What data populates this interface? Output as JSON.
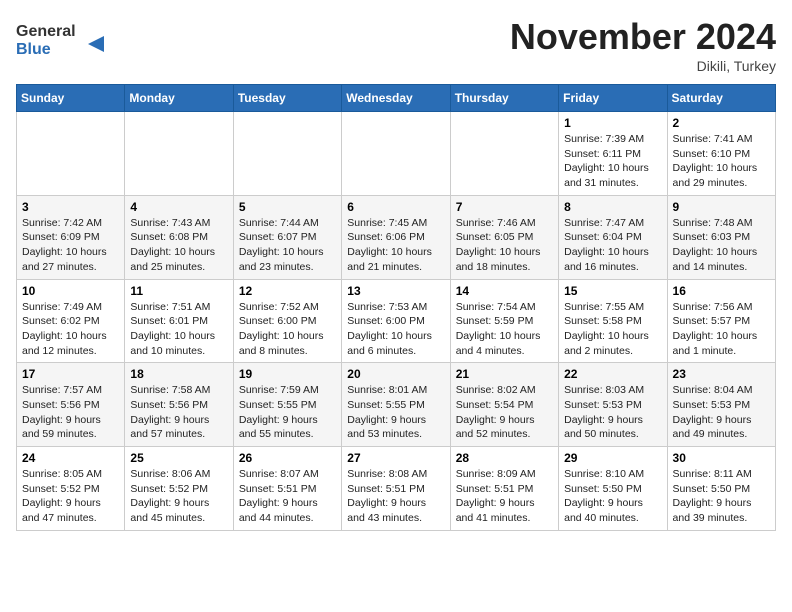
{
  "header": {
    "logo_line1": "General",
    "logo_line2": "Blue",
    "month": "November 2024",
    "location": "Dikili, Turkey"
  },
  "weekdays": [
    "Sunday",
    "Monday",
    "Tuesday",
    "Wednesday",
    "Thursday",
    "Friday",
    "Saturday"
  ],
  "weeks": [
    [
      {
        "day": "",
        "info": ""
      },
      {
        "day": "",
        "info": ""
      },
      {
        "day": "",
        "info": ""
      },
      {
        "day": "",
        "info": ""
      },
      {
        "day": "",
        "info": ""
      },
      {
        "day": "1",
        "info": "Sunrise: 7:39 AM\nSunset: 6:11 PM\nDaylight: 10 hours and 31 minutes."
      },
      {
        "day": "2",
        "info": "Sunrise: 7:41 AM\nSunset: 6:10 PM\nDaylight: 10 hours and 29 minutes."
      }
    ],
    [
      {
        "day": "3",
        "info": "Sunrise: 7:42 AM\nSunset: 6:09 PM\nDaylight: 10 hours and 27 minutes."
      },
      {
        "day": "4",
        "info": "Sunrise: 7:43 AM\nSunset: 6:08 PM\nDaylight: 10 hours and 25 minutes."
      },
      {
        "day": "5",
        "info": "Sunrise: 7:44 AM\nSunset: 6:07 PM\nDaylight: 10 hours and 23 minutes."
      },
      {
        "day": "6",
        "info": "Sunrise: 7:45 AM\nSunset: 6:06 PM\nDaylight: 10 hours and 21 minutes."
      },
      {
        "day": "7",
        "info": "Sunrise: 7:46 AM\nSunset: 6:05 PM\nDaylight: 10 hours and 18 minutes."
      },
      {
        "day": "8",
        "info": "Sunrise: 7:47 AM\nSunset: 6:04 PM\nDaylight: 10 hours and 16 minutes."
      },
      {
        "day": "9",
        "info": "Sunrise: 7:48 AM\nSunset: 6:03 PM\nDaylight: 10 hours and 14 minutes."
      }
    ],
    [
      {
        "day": "10",
        "info": "Sunrise: 7:49 AM\nSunset: 6:02 PM\nDaylight: 10 hours and 12 minutes."
      },
      {
        "day": "11",
        "info": "Sunrise: 7:51 AM\nSunset: 6:01 PM\nDaylight: 10 hours and 10 minutes."
      },
      {
        "day": "12",
        "info": "Sunrise: 7:52 AM\nSunset: 6:00 PM\nDaylight: 10 hours and 8 minutes."
      },
      {
        "day": "13",
        "info": "Sunrise: 7:53 AM\nSunset: 6:00 PM\nDaylight: 10 hours and 6 minutes."
      },
      {
        "day": "14",
        "info": "Sunrise: 7:54 AM\nSunset: 5:59 PM\nDaylight: 10 hours and 4 minutes."
      },
      {
        "day": "15",
        "info": "Sunrise: 7:55 AM\nSunset: 5:58 PM\nDaylight: 10 hours and 2 minutes."
      },
      {
        "day": "16",
        "info": "Sunrise: 7:56 AM\nSunset: 5:57 PM\nDaylight: 10 hours and 1 minute."
      }
    ],
    [
      {
        "day": "17",
        "info": "Sunrise: 7:57 AM\nSunset: 5:56 PM\nDaylight: 9 hours and 59 minutes."
      },
      {
        "day": "18",
        "info": "Sunrise: 7:58 AM\nSunset: 5:56 PM\nDaylight: 9 hours and 57 minutes."
      },
      {
        "day": "19",
        "info": "Sunrise: 7:59 AM\nSunset: 5:55 PM\nDaylight: 9 hours and 55 minutes."
      },
      {
        "day": "20",
        "info": "Sunrise: 8:01 AM\nSunset: 5:55 PM\nDaylight: 9 hours and 53 minutes."
      },
      {
        "day": "21",
        "info": "Sunrise: 8:02 AM\nSunset: 5:54 PM\nDaylight: 9 hours and 52 minutes."
      },
      {
        "day": "22",
        "info": "Sunrise: 8:03 AM\nSunset: 5:53 PM\nDaylight: 9 hours and 50 minutes."
      },
      {
        "day": "23",
        "info": "Sunrise: 8:04 AM\nSunset: 5:53 PM\nDaylight: 9 hours and 49 minutes."
      }
    ],
    [
      {
        "day": "24",
        "info": "Sunrise: 8:05 AM\nSunset: 5:52 PM\nDaylight: 9 hours and 47 minutes."
      },
      {
        "day": "25",
        "info": "Sunrise: 8:06 AM\nSunset: 5:52 PM\nDaylight: 9 hours and 45 minutes."
      },
      {
        "day": "26",
        "info": "Sunrise: 8:07 AM\nSunset: 5:51 PM\nDaylight: 9 hours and 44 minutes."
      },
      {
        "day": "27",
        "info": "Sunrise: 8:08 AM\nSunset: 5:51 PM\nDaylight: 9 hours and 43 minutes."
      },
      {
        "day": "28",
        "info": "Sunrise: 8:09 AM\nSunset: 5:51 PM\nDaylight: 9 hours and 41 minutes."
      },
      {
        "day": "29",
        "info": "Sunrise: 8:10 AM\nSunset: 5:50 PM\nDaylight: 9 hours and 40 minutes."
      },
      {
        "day": "30",
        "info": "Sunrise: 8:11 AM\nSunset: 5:50 PM\nDaylight: 9 hours and 39 minutes."
      }
    ]
  ]
}
